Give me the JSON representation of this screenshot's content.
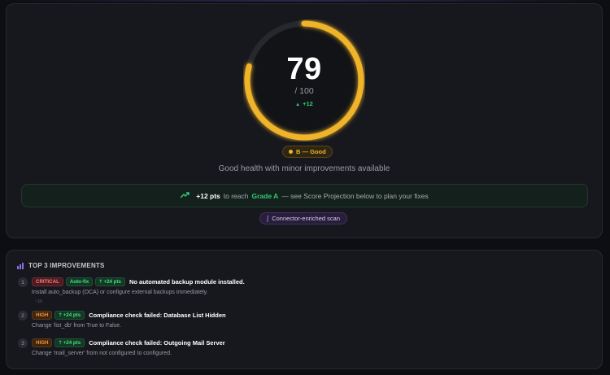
{
  "score": {
    "value": "79",
    "max_label": "/ 100",
    "delta": "+12",
    "fraction": 0.79,
    "ring_color": "#f0b429",
    "grade_label": "B — Good",
    "health_text": "Good health with minor improvements available"
  },
  "projection": {
    "points": "+12 pts",
    "to_reach": "to reach",
    "grade": "Grade A",
    "suffix": "— see Score Projection below to plan your fixes"
  },
  "scan_badge": {
    "label": "Connector-enriched scan"
  },
  "improvements": {
    "title": "TOP 3 IMPROVEMENTS",
    "items": [
      {
        "num": "1",
        "severity": "CRITICAL",
        "autofix": "Auto-fix",
        "pts": "+24 pts",
        "title": "No automated backup module installed.",
        "desc": "Install auto_backup (OCA) or configure external backups immediately.",
        "sub": "~1h"
      },
      {
        "num": "2",
        "severity": "HIGH",
        "pts": "+24 pts",
        "title": "Compliance check failed: Database List Hidden",
        "desc": "Change 'list_db' from True to False."
      },
      {
        "num": "3",
        "severity": "HIGH",
        "pts": "+24 pts",
        "title": "Compliance check failed: Outgoing Mail Server",
        "desc": "Change 'mail_server' from not configured to configured."
      }
    ]
  },
  "colors": {
    "accent_gold": "#f0b429",
    "success_green": "#33c97a",
    "critical_red": "#ff7b7b",
    "high_orange": "#f5943b",
    "purple": "#8f6ef0"
  },
  "icons": {
    "trend": "trend-up-icon",
    "link": "link-icon",
    "chart": "bar-chart-icon",
    "arrow": "arrow-up-icon"
  }
}
